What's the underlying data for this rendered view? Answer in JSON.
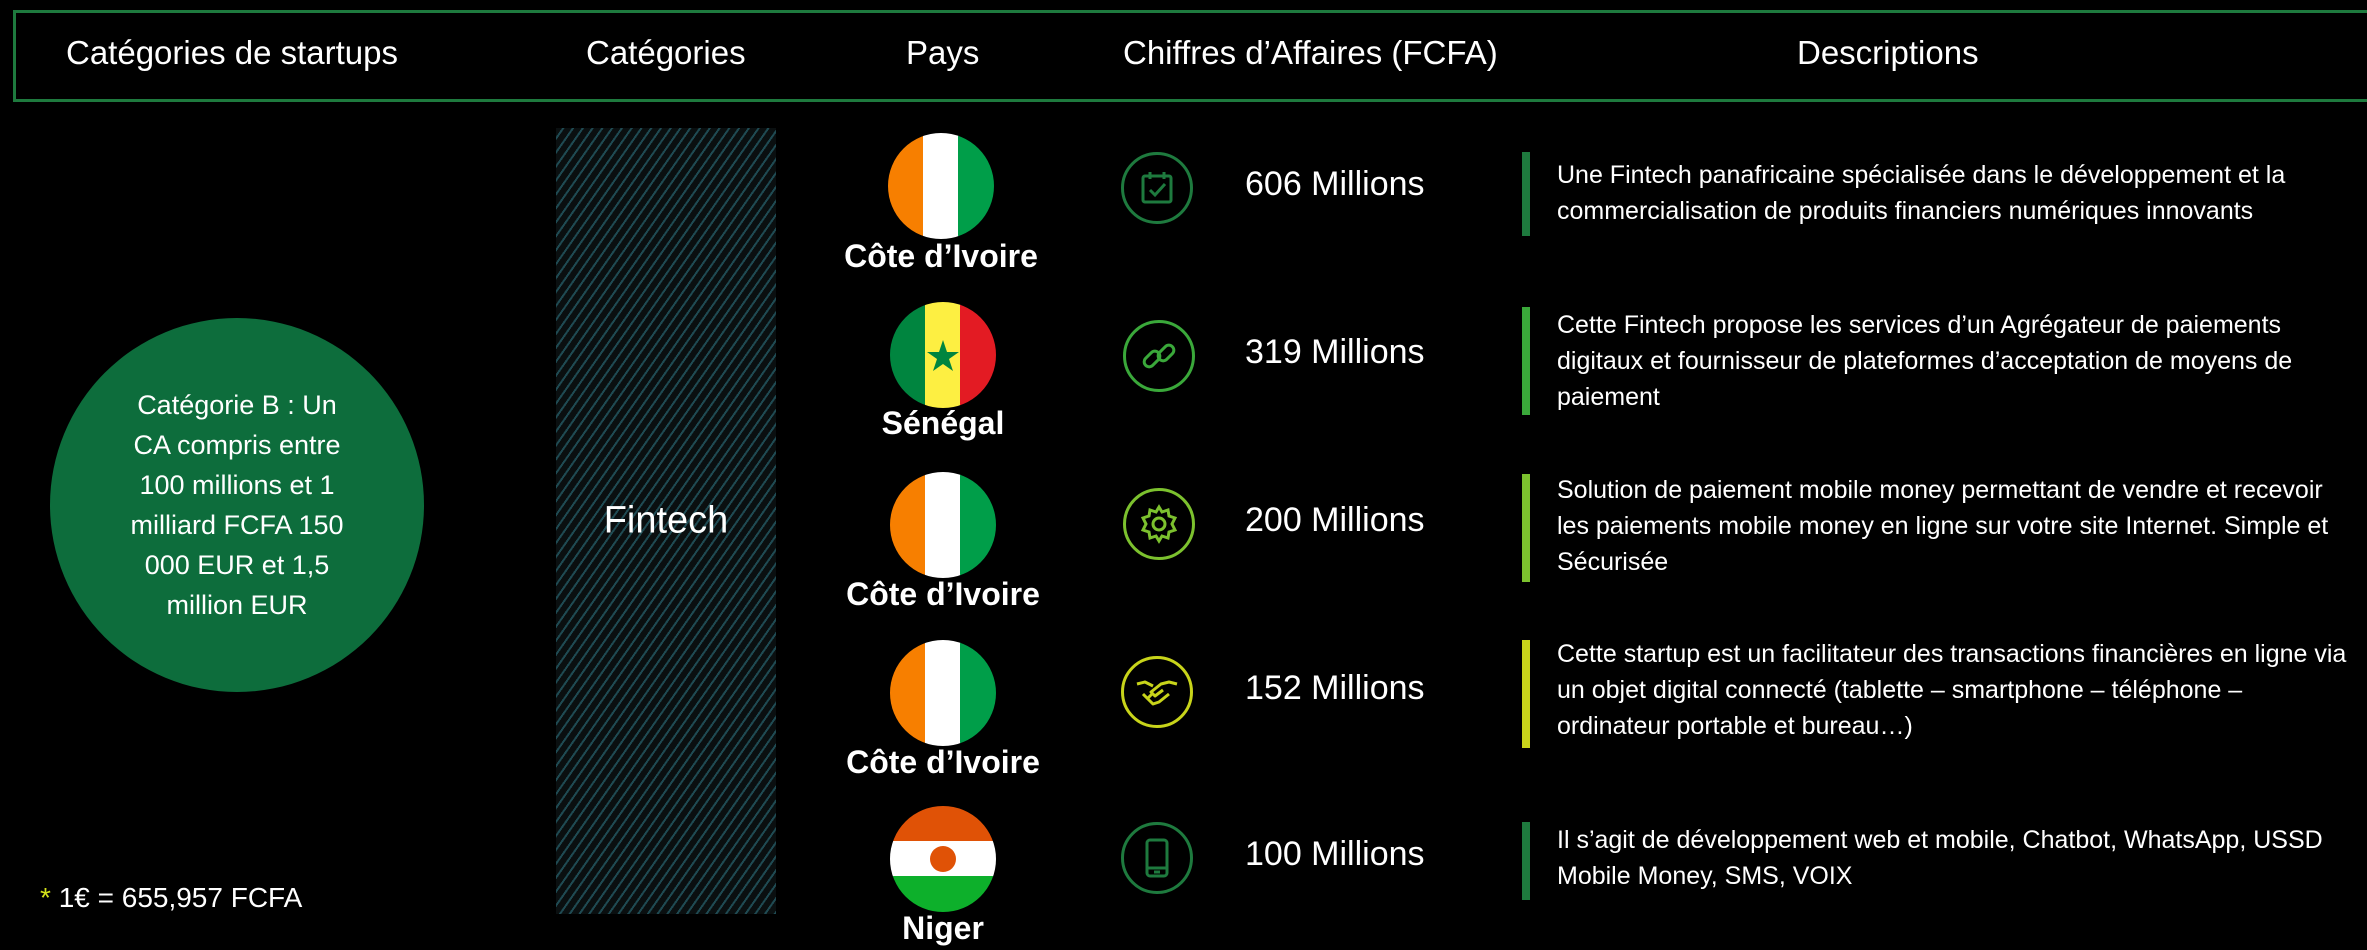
{
  "header": {
    "col1": "Catégories de startups",
    "col2": "Catégories",
    "col3": "Pays",
    "col4": "Chiffres d’Affaires (FCFA)",
    "col5": "Descriptions"
  },
  "category_circle": "Catégorie B : Un CA compris entre 100 millions et 1 milliard FCFA 150 000 EUR et 1,5 million EUR",
  "category_name": "Fintech",
  "footnote": {
    "star": "*",
    "text": "1€ = 655,957 FCFA"
  },
  "rows": [
    {
      "country": "Côte d’Ivoire",
      "flag": "cote-divoire",
      "icon": "calendar-check-icon",
      "color": "#1e7a3e",
      "amount": "606 Millions",
      "description": "Une Fintech panafricaine spécialisée dans le développement et la commercialisation de produits financiers numériques innovants"
    },
    {
      "country": "Sénégal",
      "flag": "senegal",
      "icon": "link-icon",
      "color": "#3aa83a",
      "amount": "319 Millions",
      "description": "Cette Fintech propose les services d’un Agrégateur de paiements digitaux et fournisseur de plateformes d’acceptation de moyens de paiement"
    },
    {
      "country": "Côte d’Ivoire",
      "flag": "cote-divoire",
      "icon": "gear-icon",
      "color": "#7cc12e",
      "amount": "200 Millions",
      "description": "Solution de paiement mobile money permettant de vendre et recevoir les paiements mobile money en ligne sur votre site Internet. Simple et Sécurisée"
    },
    {
      "country": "Côte d’Ivoire",
      "flag": "cote-divoire",
      "icon": "handshake-icon",
      "color": "#c8d41a",
      "amount": "152 Millions",
      "description": "Cette startup est un facilitateur des transactions financières en ligne via un objet digital connecté (tablette – smartphone – téléphone – ordinateur portable et bureau…)"
    },
    {
      "country": "Niger",
      "flag": "niger",
      "icon": "smartphone-icon",
      "color": "#1e7a3e",
      "amount": "100 Millions",
      "description": "Il s’agit de développement web et mobile, Chatbot, WhatsApp, USSD Mobile Money, SMS, VOIX"
    }
  ]
}
